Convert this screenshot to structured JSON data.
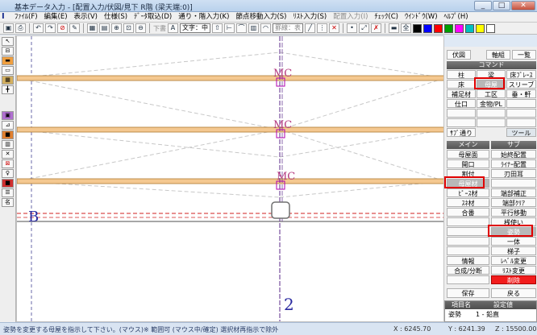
{
  "window": {
    "title": "基本データ入力 - [配置入力/伏図/見下 R階 (梁天端:0)]",
    "min": "_",
    "max": "□",
    "close": "✕"
  },
  "menu": [
    {
      "label": "ﾌｧｲﾙ(F)"
    },
    {
      "label": "編集(E)"
    },
    {
      "label": "表示(V)"
    },
    {
      "label": "仕様(S)"
    },
    {
      "label": "ﾃﾞｰﾀ取込(D)"
    },
    {
      "label": "通り・階入力(K)"
    },
    {
      "label": "節点移動入力(S)"
    },
    {
      "label": "ﾘｽﾄ入力(S)"
    },
    {
      "label": "配置入力(I)",
      "disabled": true
    },
    {
      "label": "ﾁｪｯｸ(C)"
    },
    {
      "label": "ｳｲﾝﾄﾞｳ(W)"
    },
    {
      "label": "ﾍﾙﾌﾟ(H)"
    }
  ],
  "toolbar": {
    "text_label": "下書",
    "font_select": "文字：中",
    "line_select": "罫線：表",
    "colors": [
      "#000000",
      "#0000ff",
      "#ff0000",
      "#00a000",
      "#ff00ff",
      "#00c0c0",
      "#ffff00",
      "#ffffff"
    ]
  },
  "canvas": {
    "grid_label_B": "B",
    "grid_label_2": "2",
    "beam_labels": [
      "MC",
      "MC",
      "MC"
    ]
  },
  "panel": {
    "top_buttons": [
      "伏図",
      "軸組",
      "一覧"
    ],
    "command_header": "コマンド",
    "command_buttons": [
      "柱",
      "梁",
      "床ﾌﾞﾚｰｽ",
      "床",
      "母屋",
      "スリーブ",
      "補足材",
      "工区",
      "垂・軒",
      "仕口",
      "金物/PL"
    ],
    "tool_left": "ｻﾌﾞ通り",
    "tool_right": "ツール",
    "main_header": "メイン",
    "sub_header": "サブ",
    "main_buttons": [
      "母屋面",
      "開口",
      "割付",
      "母屋材",
      "ﾋﾟｰｽ材",
      "ｽﾈ材",
      "合番",
      "",
      "",
      "情報",
      "合成/分断"
    ],
    "sub_buttons": [
      "始終配置",
      "ﾗｲﾅｰ配置",
      "刃田耳",
      "端部補正",
      "端部ｸﾘｱ",
      "平行移動",
      "桟使い",
      "姿勢",
      "一体",
      "梯子",
      "ﾚﾍﾞﾙ変更",
      "ﾘｽﾄ変更",
      "削除"
    ],
    "save": "保存",
    "back": "戻る",
    "grid_header_left": "項目名",
    "grid_header_right": "設定値",
    "grid_row_left": "姿勢",
    "grid_row_right": "1 - 鉛直"
  },
  "status": {
    "message": "姿勢を変更する母屋を指示して下さい。(マウス)※ 範囲可 (マウス中/確定) 選択材再指示で除外",
    "x": "X : 6245.70",
    "y": "Y : 6241.39",
    "z": "Z : 15500.00"
  }
}
